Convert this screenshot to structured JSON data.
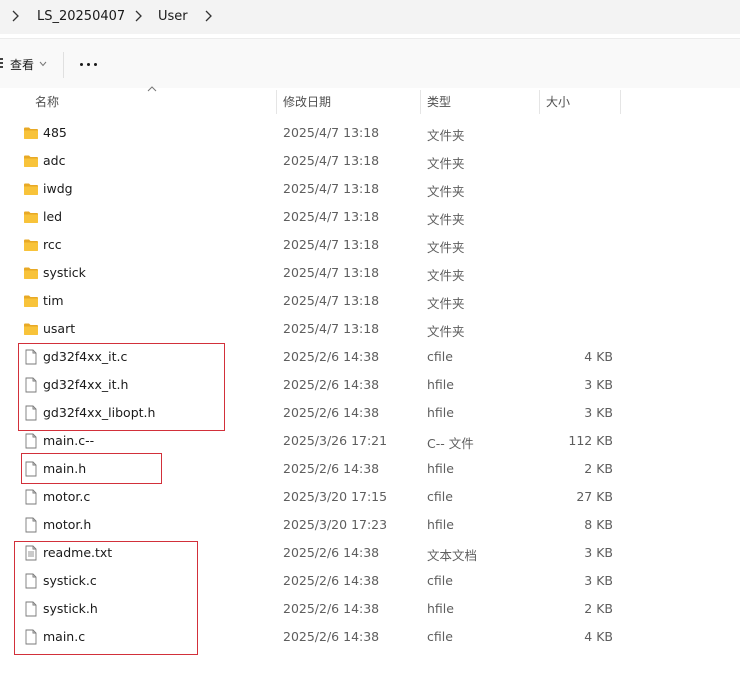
{
  "breadcrumb": {
    "items": [
      "LS_20250407",
      "User"
    ]
  },
  "toolbar": {
    "view_label": "查看",
    "more_label": "..."
  },
  "columns": {
    "name": "名称",
    "date": "修改日期",
    "type": "类型",
    "size": "大小"
  },
  "files": [
    {
      "name": "485",
      "date": "2025/4/7 13:18",
      "type": "文件夹",
      "size": "",
      "icon": "folder"
    },
    {
      "name": "adc",
      "date": "2025/4/7 13:18",
      "type": "文件夹",
      "size": "",
      "icon": "folder"
    },
    {
      "name": "iwdg",
      "date": "2025/4/7 13:18",
      "type": "文件夹",
      "size": "",
      "icon": "folder"
    },
    {
      "name": "led",
      "date": "2025/4/7 13:18",
      "type": "文件夹",
      "size": "",
      "icon": "folder"
    },
    {
      "name": "rcc",
      "date": "2025/4/7 13:18",
      "type": "文件夹",
      "size": "",
      "icon": "folder"
    },
    {
      "name": "systick",
      "date": "2025/4/7 13:18",
      "type": "文件夹",
      "size": "",
      "icon": "folder"
    },
    {
      "name": "tim",
      "date": "2025/4/7 13:18",
      "type": "文件夹",
      "size": "",
      "icon": "folder"
    },
    {
      "name": "usart",
      "date": "2025/4/7 13:18",
      "type": "文件夹",
      "size": "",
      "icon": "folder"
    },
    {
      "name": "gd32f4xx_it.c",
      "date": "2025/2/6 14:38",
      "type": "cfile",
      "size": "4 KB",
      "icon": "file"
    },
    {
      "name": "gd32f4xx_it.h",
      "date": "2025/2/6 14:38",
      "type": "hfile",
      "size": "3 KB",
      "icon": "file"
    },
    {
      "name": "gd32f4xx_libopt.h",
      "date": "2025/2/6 14:38",
      "type": "hfile",
      "size": "3 KB",
      "icon": "file"
    },
    {
      "name": "main.c--",
      "date": "2025/3/26 17:21",
      "type": "C-- 文件",
      "size": "112 KB",
      "icon": "file"
    },
    {
      "name": "main.h",
      "date": "2025/2/6 14:38",
      "type": "hfile",
      "size": "2 KB",
      "icon": "file"
    },
    {
      "name": "motor.c",
      "date": "2025/3/20 17:15",
      "type": "cfile",
      "size": "27 KB",
      "icon": "file"
    },
    {
      "name": "motor.h",
      "date": "2025/3/20 17:23",
      "type": "hfile",
      "size": "8 KB",
      "icon": "file"
    },
    {
      "name": "readme.txt",
      "date": "2025/2/6 14:38",
      "type": "文本文档",
      "size": "3 KB",
      "icon": "text-file"
    },
    {
      "name": "systick.c",
      "date": "2025/2/6 14:38",
      "type": "cfile",
      "size": "3 KB",
      "icon": "file"
    },
    {
      "name": "systick.h",
      "date": "2025/2/6 14:38",
      "type": "hfile",
      "size": "2 KB",
      "icon": "file"
    },
    {
      "name": "main.c",
      "date": "2025/2/6 14:38",
      "type": "cfile",
      "size": "4 KB",
      "icon": "file"
    }
  ],
  "colors": {
    "highlight": "#d2303a",
    "folder": "#f8c33a"
  }
}
